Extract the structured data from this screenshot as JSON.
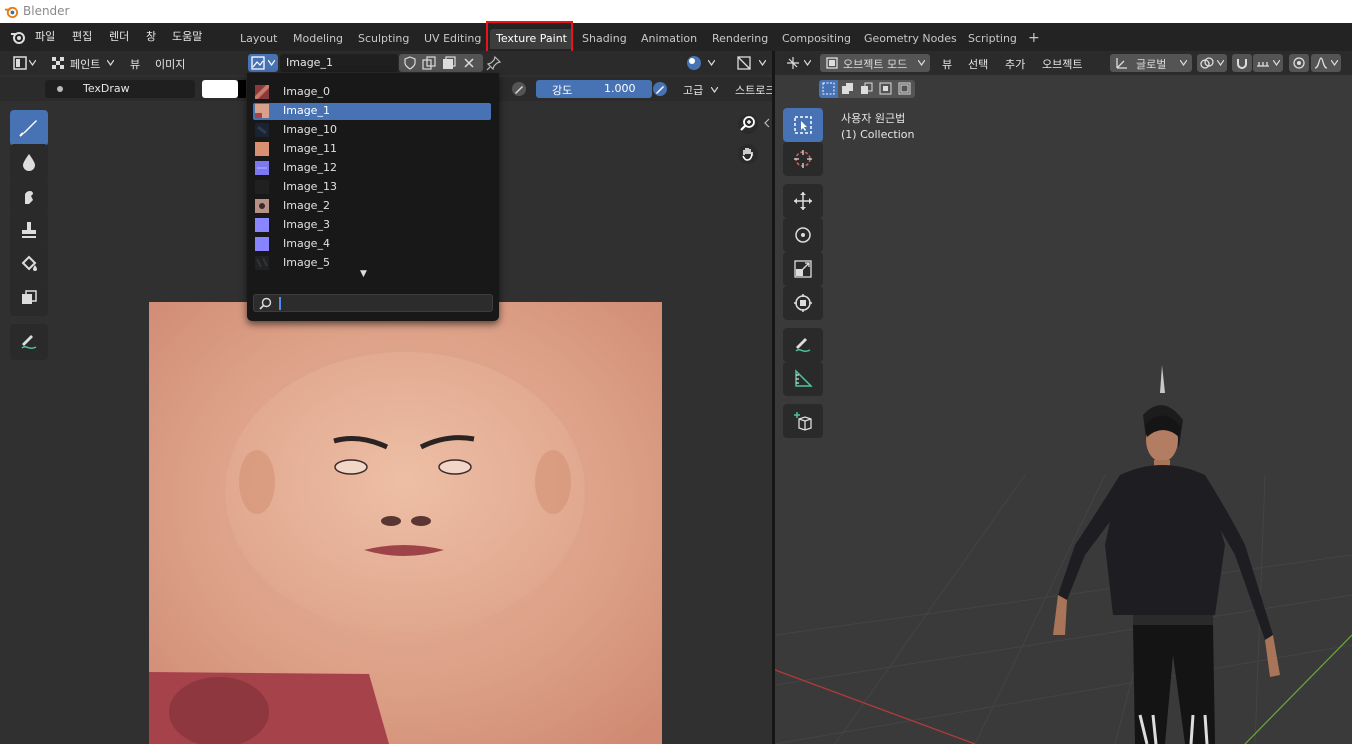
{
  "titlebar": {
    "title": "Blender"
  },
  "menu": {
    "items": [
      "파일",
      "편집",
      "렌더",
      "창",
      "도움말"
    ]
  },
  "workspaces": {
    "tabs": [
      "Layout",
      "Modeling",
      "Sculpting",
      "UV Editing",
      "Texture Paint",
      "Shading",
      "Animation",
      "Rendering",
      "Compositing",
      "Geometry Nodes",
      "Scripting"
    ],
    "active": "Texture Paint",
    "add": "+"
  },
  "image_editor": {
    "mode_label": "페인트",
    "view_menu": "뷰",
    "image_menu": "이미지",
    "image_name": "Image_1",
    "brush_name": "TexDraw",
    "strength_label": "강도",
    "strength_value": "1.000",
    "advanced_label": "고급",
    "stroke_label": "스트로크"
  },
  "dropdown": {
    "items": [
      "Image_0",
      "Image_1",
      "Image_10",
      "Image_11",
      "Image_12",
      "Image_13",
      "Image_2",
      "Image_3",
      "Image_4",
      "Image_5"
    ],
    "selected": "Image_1",
    "more_arrow": "▼"
  },
  "viewport": {
    "mode_label": "오브젝트 모드",
    "view_menu": "뷰",
    "select_menu": "선택",
    "add_menu": "추가",
    "object_menu": "오브젝트",
    "orientation": "글로벌",
    "overlay_text_1": "사용자 원근법",
    "overlay_text_2": "(1) Collection"
  },
  "colors": {
    "accent": "#4772b3",
    "highlight": "#e8141b",
    "panel": "#303030"
  }
}
